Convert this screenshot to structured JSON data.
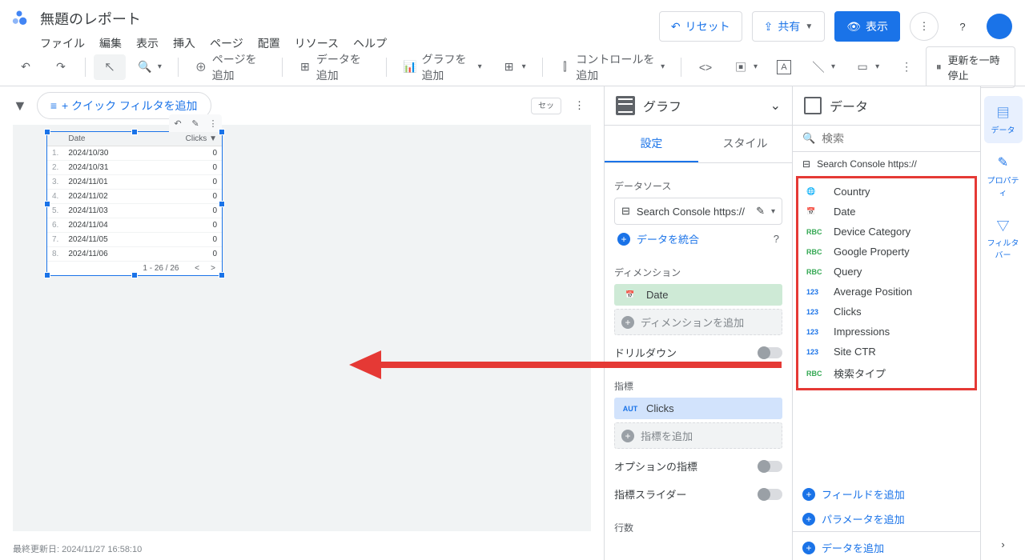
{
  "header": {
    "doc_title": "無題のレポート",
    "menus": [
      "ファイル",
      "編集",
      "表示",
      "挿入",
      "ページ",
      "配置",
      "リソース",
      "ヘルプ"
    ],
    "reset": "リセット",
    "share": "共有",
    "view": "表示"
  },
  "toolbar": {
    "add_page": "ページを追加",
    "add_data": "データを追加",
    "add_chart": "グラフを追加",
    "add_control": "コントロールを追加",
    "pause": "更新を一時停止"
  },
  "filter": {
    "quick": "+ クイック フィルタを追加",
    "settings_label": "セッ"
  },
  "table": {
    "header_date": "Date",
    "header_clicks": "Clicks",
    "rows": [
      {
        "i": "1.",
        "d": "2024/10/30",
        "c": "0"
      },
      {
        "i": "2.",
        "d": "2024/10/31",
        "c": "0"
      },
      {
        "i": "3.",
        "d": "2024/11/01",
        "c": "0"
      },
      {
        "i": "4.",
        "d": "2024/11/02",
        "c": "0"
      },
      {
        "i": "5.",
        "d": "2024/11/03",
        "c": "0"
      },
      {
        "i": "6.",
        "d": "2024/11/04",
        "c": "0"
      },
      {
        "i": "7.",
        "d": "2024/11/05",
        "c": "0"
      },
      {
        "i": "8.",
        "d": "2024/11/06",
        "c": "0"
      }
    ],
    "pager": "1 - 26 / 26"
  },
  "footer": "最終更新日: 2024/11/27 16:58:10",
  "setup_panel": {
    "title": "グラフ",
    "tab_setup": "設定",
    "tab_style": "スタイル",
    "data_source": "データソース",
    "ds_name": "Search Console https://",
    "blend": "データを統合",
    "dimension": "ディメンション",
    "dim_date": "Date",
    "add_dim": "ディメンションを追加",
    "drilldown": "ドリルダウン",
    "metric": "指標",
    "metric_clicks": "Clicks",
    "add_metric": "指標を追加",
    "opt_metric": "オプションの指標",
    "metric_slider": "指標スライダー",
    "rows": "行数"
  },
  "data_panel": {
    "title": "データ",
    "search_ph": "検索",
    "ds_label": "Search Console https://",
    "fields": [
      {
        "type": "globe",
        "name": "Country"
      },
      {
        "type": "cal",
        "name": "Date"
      },
      {
        "type": "rbc",
        "name": "Device Category"
      },
      {
        "type": "rbc",
        "name": "Google Property"
      },
      {
        "type": "rbc",
        "name": "Query"
      },
      {
        "type": "123",
        "name": "Average Position"
      },
      {
        "type": "123",
        "name": "Clicks"
      },
      {
        "type": "123",
        "name": "Impressions"
      },
      {
        "type": "123",
        "name": "Site CTR"
      },
      {
        "type": "rbc",
        "name": "検索タイプ"
      }
    ],
    "add_field": "フィールドを追加",
    "add_param": "パラメータを追加",
    "add_data": "データを追加"
  },
  "right_tabs": {
    "data": "データ",
    "property": "プロパティ",
    "filterbar": "フィルタバー"
  }
}
